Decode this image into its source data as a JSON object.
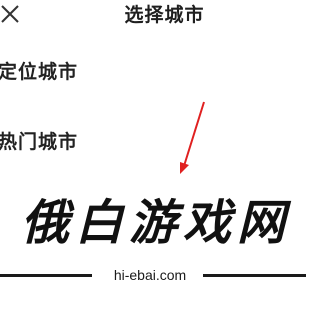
{
  "header": {
    "title": "选择城市",
    "close_icon": "close-icon"
  },
  "sections": {
    "location_label": "定位城市",
    "hot_label": "热门城市"
  },
  "annotation": {
    "arrow_color": "#e02020"
  },
  "watermark": {
    "brand": "俄白游戏网",
    "url": "hi-ebai.com"
  }
}
